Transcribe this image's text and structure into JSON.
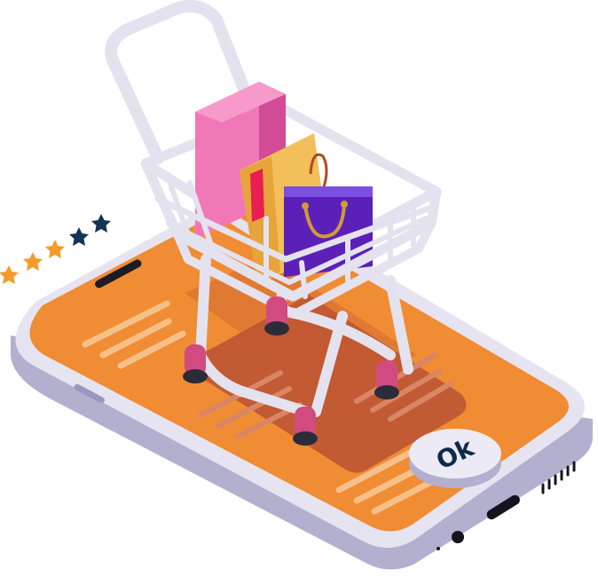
{
  "illustration": {
    "ok_button": {
      "label": "Ok"
    },
    "rating": {
      "filled_stars": 3,
      "total_stars": 5
    }
  },
  "colors": {
    "screen": "#F08C33",
    "phone_body": "#E7E4F1",
    "phone_side": "#B2AECF",
    "star_filled": "#F59A2A",
    "star_empty": "#123356",
    "cart_frame": "#E4E2EF",
    "bag_pink": "#F178B6",
    "bag_yellow": "#F2BF5A",
    "bag_purple": "#5A20B8",
    "ok_text": "#0E2A4A"
  },
  "icons": [
    "star-icon",
    "shopping-cart-icon",
    "shopping-bag-icon"
  ]
}
